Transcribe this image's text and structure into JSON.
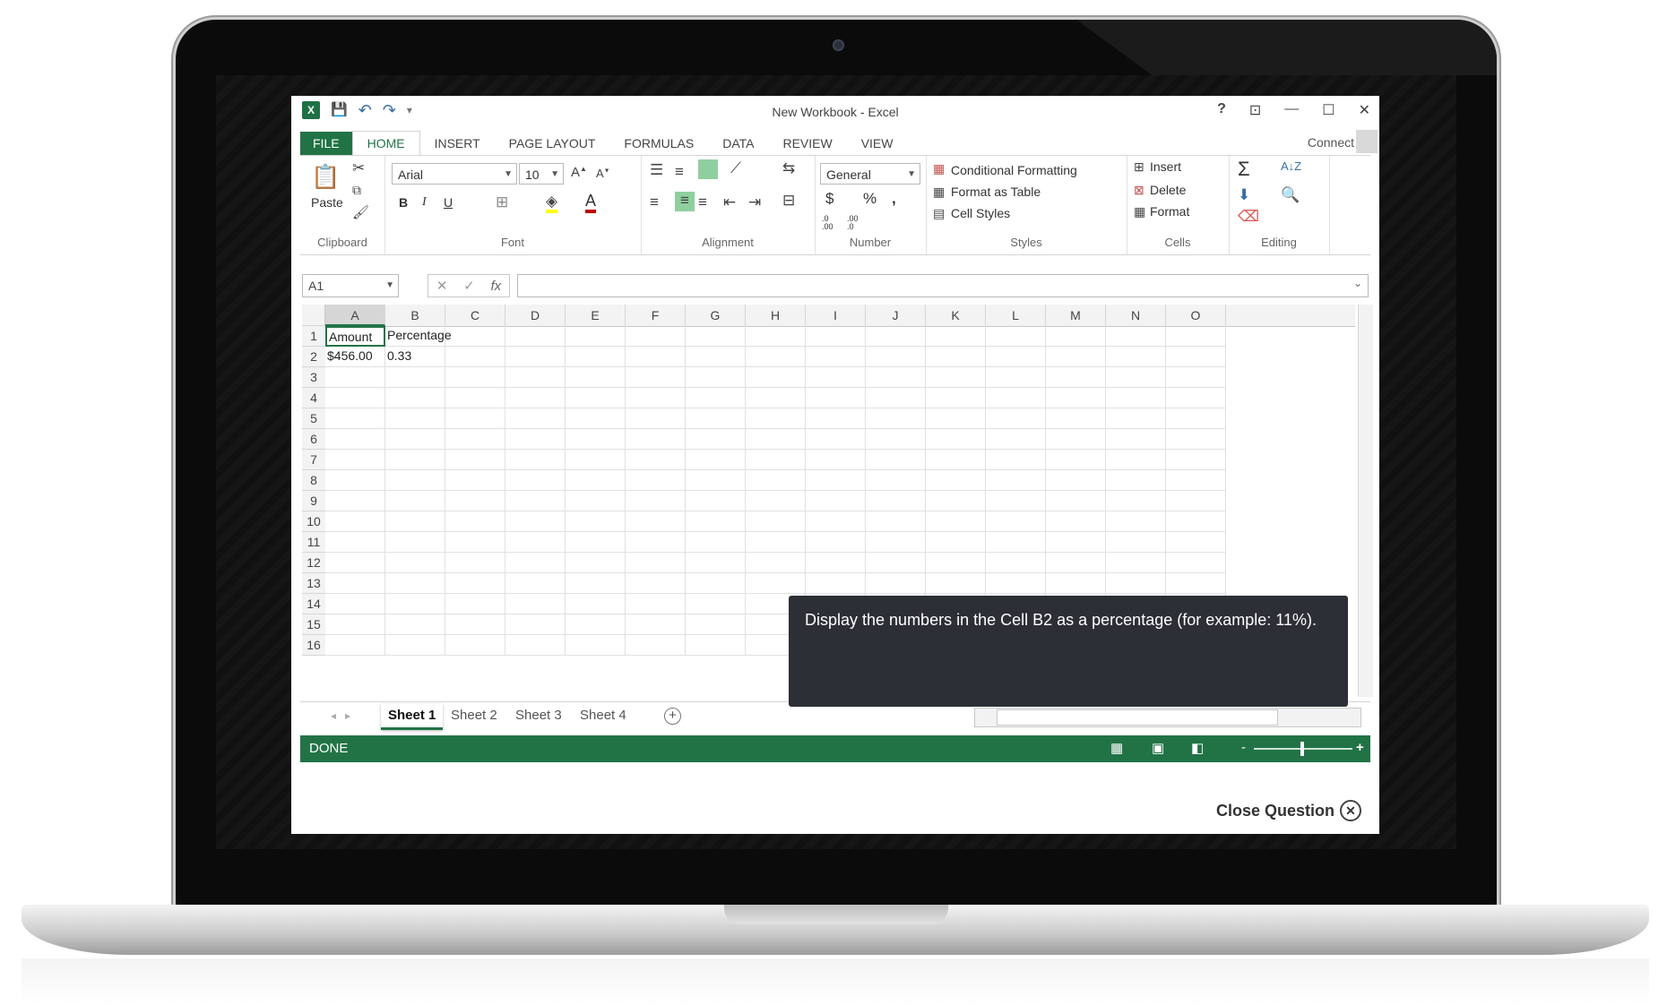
{
  "window": {
    "title": "New Workbook - Excel",
    "help": "?",
    "restore_ribbon": "⊡",
    "minimize": "—",
    "maximize": "☐",
    "close": "✕"
  },
  "qat": {
    "logo": "X",
    "save": "💾",
    "undo": "↶",
    "redo": "↷",
    "customize": "▾"
  },
  "tabs": [
    {
      "label": "FILE"
    },
    {
      "label": "HOME"
    },
    {
      "label": "INSERT"
    },
    {
      "label": "PAGE LAYOUT"
    },
    {
      "label": "FORMULAS"
    },
    {
      "label": "DATA"
    },
    {
      "label": "REVIEW"
    },
    {
      "label": "VIEW"
    }
  ],
  "account": {
    "connect": "Connect"
  },
  "ribbon": {
    "clipboard": {
      "label": "Clipboard",
      "paste": "Paste"
    },
    "font": {
      "label": "Font",
      "family": "Arial",
      "size": "10",
      "bold": "B",
      "italic": "I",
      "underline": "U",
      "font_color_glyph": "A"
    },
    "alignment": {
      "label": "Alignment"
    },
    "number": {
      "label": "Number",
      "format": "General",
      "currency": "$",
      "percent": "%",
      "comma": ",",
      "inc_decimal": ".0 .00",
      "dec_decimal": ".00 .0"
    },
    "styles": {
      "label": "Styles",
      "conditional": "Conditional Formatting",
      "format_table": "Format as Table",
      "cell_styles": "Cell Styles"
    },
    "cells": {
      "label": "Cells",
      "insert": "Insert",
      "delete": "Delete",
      "format": "Format"
    },
    "editing": {
      "label": "Editing",
      "sum": "Σ"
    }
  },
  "formula_bar": {
    "name_box": "A1",
    "cancel": "✕",
    "enter": "✓",
    "fx": "fx",
    "value": ""
  },
  "grid": {
    "columns": [
      "A",
      "B",
      "C",
      "D",
      "E",
      "F",
      "G",
      "H",
      "I",
      "J",
      "K",
      "L",
      "M",
      "N",
      "O"
    ],
    "rows": [
      "1",
      "2",
      "3",
      "4",
      "5",
      "6",
      "7",
      "8",
      "9",
      "10",
      "11",
      "12",
      "13",
      "14",
      "15",
      "16"
    ],
    "cells": {
      "A1": "Amount",
      "B1": "Percentage",
      "A2": "$456.00",
      "B2": "0.33"
    },
    "active_cell": "A1"
  },
  "sheets": [
    {
      "label": "Sheet 1",
      "active": true
    },
    {
      "label": "Sheet 2"
    },
    {
      "label": "Sheet 3"
    },
    {
      "label": "Sheet 4"
    }
  ],
  "status": {
    "text": "DONE",
    "zoom_minus": "-",
    "zoom_plus": "+"
  },
  "question": {
    "text": "Display the numbers in the Cell B2 as a percentage (for example: 11%).",
    "close": "Close Question"
  },
  "colors": {
    "accent": "#217346",
    "tooltip_bg": "#2d2f36"
  }
}
